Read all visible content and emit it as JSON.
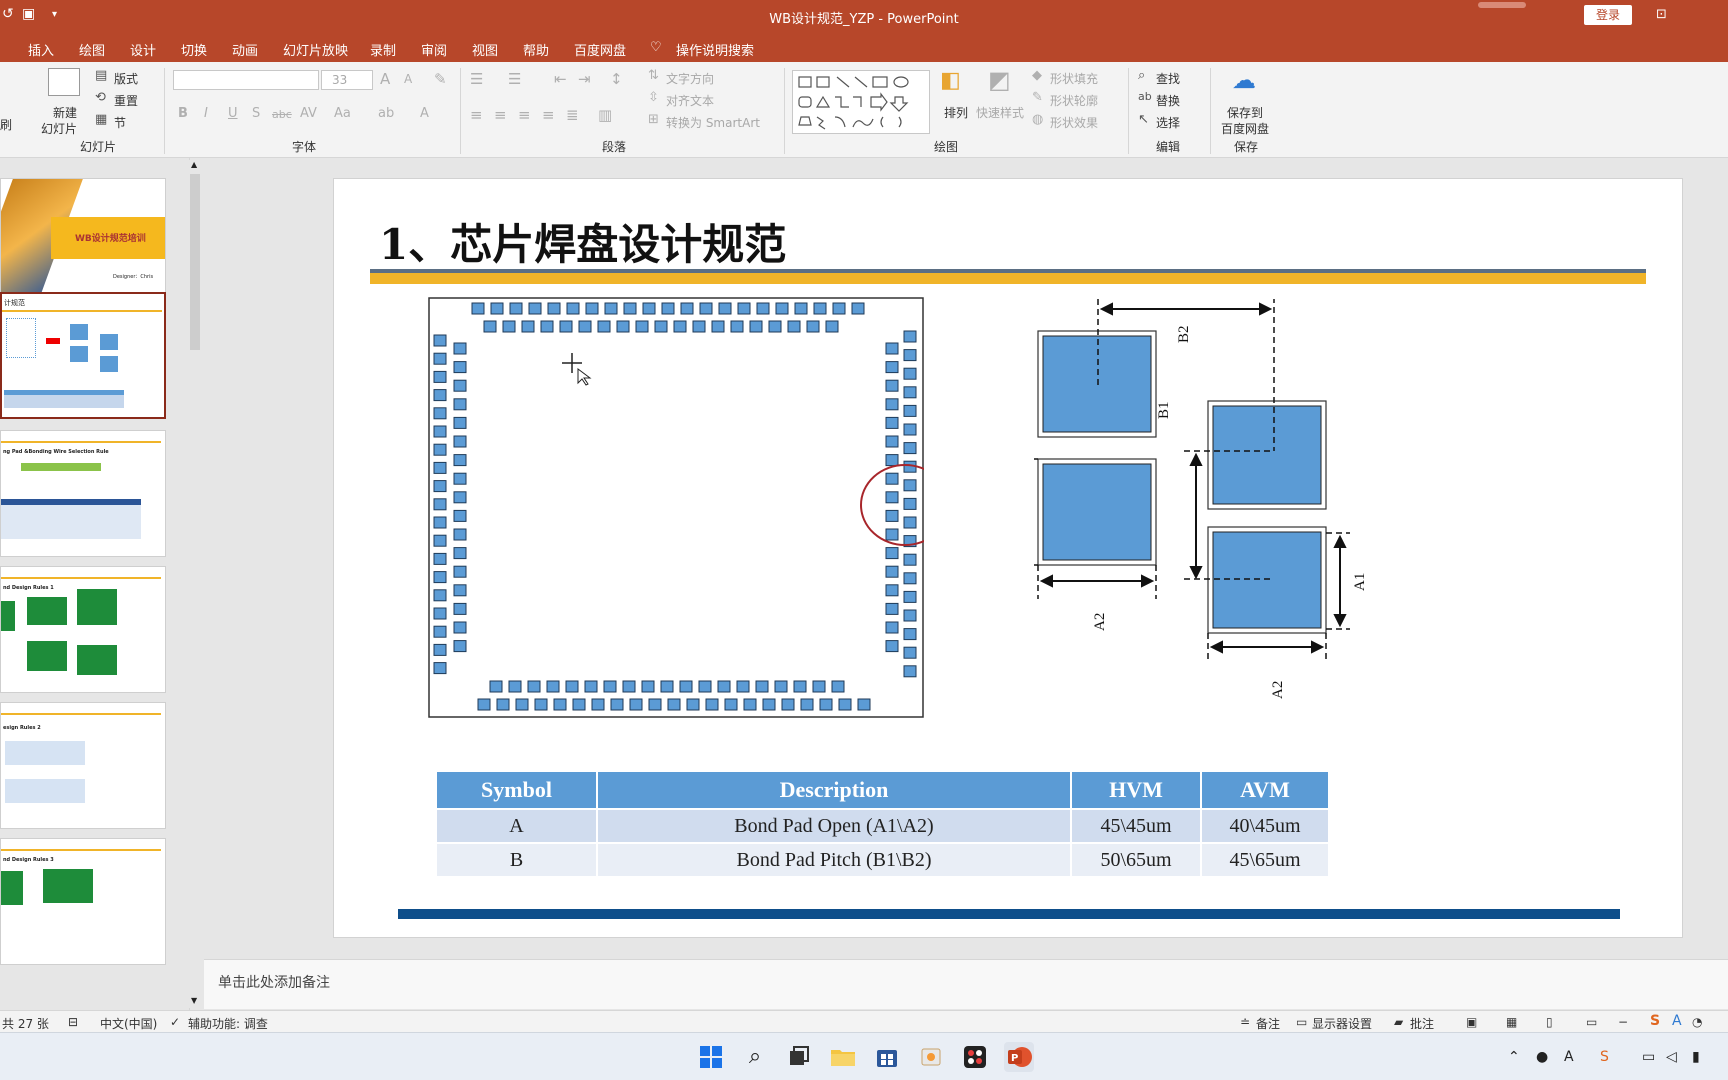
{
  "window": {
    "title": "WB设计规范_YZP  -  PowerPoint",
    "login": "登录"
  },
  "menu": {
    "tabs": [
      "插入",
      "绘图",
      "设计",
      "切换",
      "动画",
      "幻灯片放映",
      "录制",
      "审阅",
      "视图",
      "帮助",
      "百度网盘"
    ],
    "search": "操作说明搜索"
  },
  "ribbon": {
    "slides": {
      "new_slide": "新建",
      "new_slide2": "幻灯片",
      "layout": "版式",
      "reset": "重置",
      "section": "节",
      "group": "幻灯片",
      "brush": "刷"
    },
    "font": {
      "size": "33",
      "group": "字体"
    },
    "paragraph": {
      "text_dir": "文字方向",
      "align_text": "对齐文本",
      "smartart": "转换为 SmartArt",
      "group": "段落"
    },
    "drawing": {
      "arrange": "排列",
      "quick_styles": "快速样式",
      "fill": "形状填充",
      "outline": "形状轮廓",
      "effects": "形状效果",
      "group": "绘图"
    },
    "editing": {
      "find": "查找",
      "replace": "替换",
      "select": "选择",
      "group": "编辑"
    },
    "save": {
      "line1": "保存到",
      "line2": "百度网盘",
      "group": "保存"
    }
  },
  "thumbnails": {
    "t1_title": "WB设计规范培训",
    "t1_designer": "Designer：Chris",
    "t2_title": "计规范",
    "t3_title": "ng Pad &Bonding Wire Selection Rule",
    "t4_title": "nd Design Rules 1",
    "t5_title": "esign Rules 2",
    "t6_title": "nd Design Rules 3"
  },
  "slide": {
    "title": "1、芯片焊盘设计规范",
    "dim_labels": {
      "a1": "A1",
      "a2": "A2",
      "b1": "B1",
      "b2": "B2"
    },
    "table": {
      "headers": [
        "Symbol",
        "Description",
        "HVM",
        "AVM"
      ],
      "rows": [
        [
          "A",
          "Bond Pad Open (A1\\A2)",
          "45\\45um",
          "40\\45um"
        ],
        [
          "B",
          "Bond Pad Pitch  (B1\\B2)",
          "50\\65um",
          "45\\65um"
        ]
      ]
    }
  },
  "notes": {
    "placeholder": "单击此处添加备注"
  },
  "status": {
    "slide_count": "共 27 张",
    "language": "中文(中国)",
    "accessibility": "辅助功能: 调查",
    "notes_btn": "备注",
    "display": "显示器设置",
    "comments": "批注"
  },
  "colors": {
    "accent": "#b7472a",
    "pad_blue": "#5b9bd5",
    "title_gold": "#f0b429",
    "footer_blue": "#0e4e8a"
  }
}
